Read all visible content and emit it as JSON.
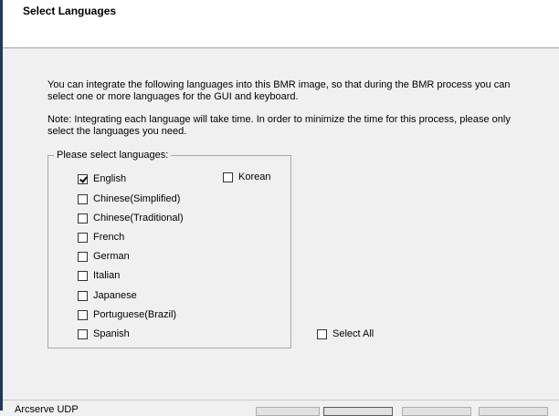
{
  "header": {
    "title": "Select Languages"
  },
  "intro_text": "You can integrate the following languages into this BMR image, so that during the BMR process you can select one or more languages for the GUI and keyboard.",
  "note_text": "Note: Integrating each language will take time. In order to minimize the time for this process, please only select the languages you need.",
  "languages_group": {
    "legend": "Please select languages:",
    "items": [
      {
        "label": "English",
        "checked": true
      },
      {
        "label": "Chinese(Simplified)",
        "checked": false
      },
      {
        "label": "Chinese(Traditional)",
        "checked": false
      },
      {
        "label": "French",
        "checked": false
      },
      {
        "label": "German",
        "checked": false
      },
      {
        "label": "Italian",
        "checked": false
      },
      {
        "label": "Japanese",
        "checked": false
      },
      {
        "label": "Portuguese(Brazil)",
        "checked": false
      },
      {
        "label": "Spanish",
        "checked": false
      },
      {
        "label": "Korean",
        "checked": false
      }
    ]
  },
  "select_all": {
    "label": "Select All",
    "checked": false
  },
  "footer": {
    "label": "Arcserve UDP"
  }
}
